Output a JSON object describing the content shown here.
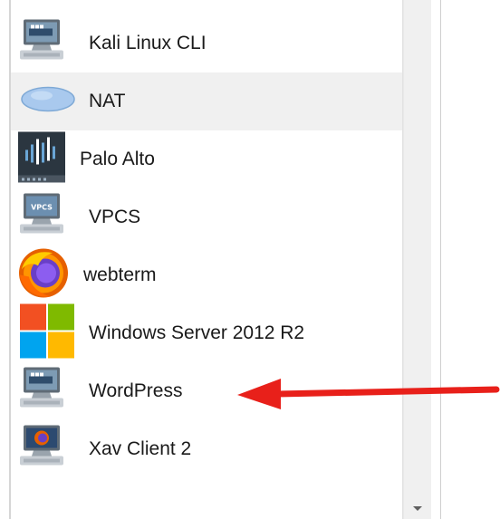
{
  "device_list": {
    "items": [
      {
        "label": "Kali Linux CLI",
        "icon": "docker-monitor-icon"
      },
      {
        "label": "NAT",
        "icon": "cloud-icon"
      },
      {
        "label": "Palo Alto",
        "icon": "palo-alto-appliance-icon"
      },
      {
        "label": "VPCS",
        "icon": "vpcs-monitor-icon"
      },
      {
        "label": "webterm",
        "icon": "firefox-icon"
      },
      {
        "label": "Windows Server 2012 R2",
        "icon": "windows-logo-icon"
      },
      {
        "label": "WordPress",
        "icon": "docker-monitor-icon"
      },
      {
        "label": "Xav Client 2",
        "icon": "firefox-monitor-icon"
      }
    ],
    "selected_item": "NAT"
  },
  "scrollbar": {
    "down_arrow_icon": "chevron-down-icon"
  },
  "annotation": {
    "arrow_color": "#e8201a",
    "points_to": "WordPress"
  },
  "colors": {
    "selected_row": "#f0f0f0",
    "text": "#1a1a1a",
    "windows_red": "#f25022",
    "windows_green": "#7fba00",
    "windows_blue": "#00a4ef",
    "windows_yellow": "#ffb900"
  }
}
